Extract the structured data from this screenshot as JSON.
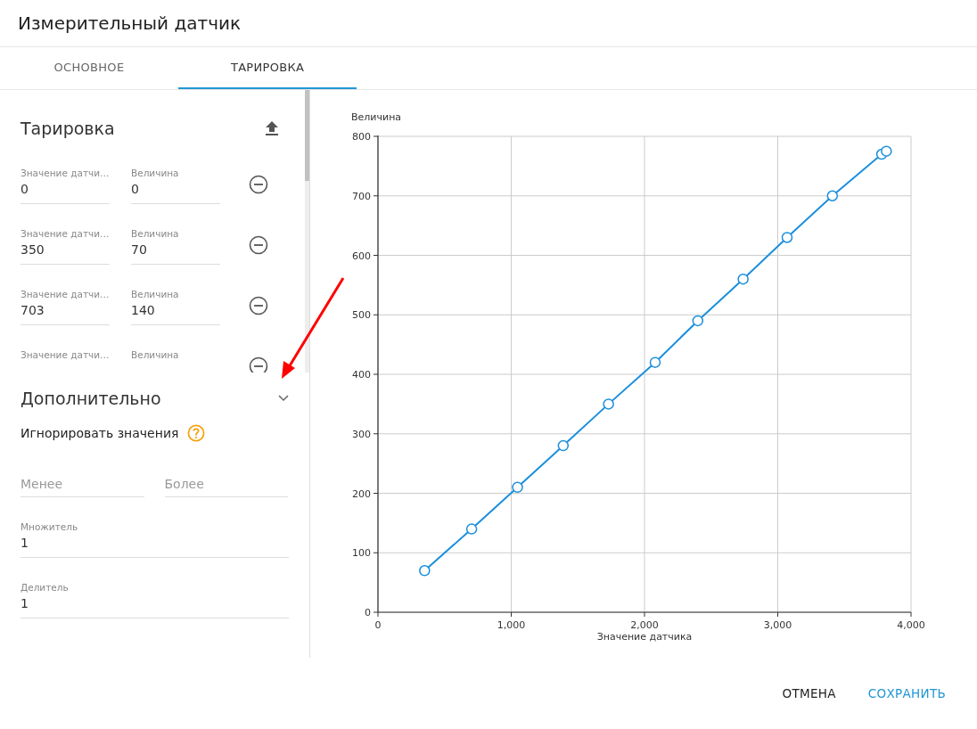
{
  "dialog": {
    "title": "Измерительный датчик"
  },
  "tabs": [
    {
      "label": "ОСНОВНОЕ",
      "selected": false
    },
    {
      "label": "ТАРИРОВКА",
      "selected": true
    }
  ],
  "calibration": {
    "title": "Тарировка",
    "rows": [
      {
        "sensor_label": "Значение датчи…",
        "sensor_value": "0",
        "quantity_label": "Величина",
        "quantity_value": "0"
      },
      {
        "sensor_label": "Значение датчи…",
        "sensor_value": "350",
        "quantity_label": "Величина",
        "quantity_value": "70"
      },
      {
        "sensor_label": "Значение датчи…",
        "sensor_value": "703",
        "quantity_label": "Величина",
        "quantity_value": "140"
      },
      {
        "sensor_label": "Значение датчи…",
        "quantity_label": "Величина"
      }
    ]
  },
  "additional": {
    "title": "Дополнительно",
    "ignore_label": "Игнорировать значения",
    "less": {
      "placeholder": "Менее"
    },
    "more": {
      "placeholder": "Более"
    },
    "multiplier": {
      "label": "Множитель",
      "value": "1"
    },
    "divider": {
      "label": "Делитель",
      "value": "1"
    }
  },
  "chart": {
    "chart_data": {
      "type": "line",
      "xlabel": "Значение датчика",
      "ylabel": "Величина",
      "xlim": [
        0,
        4000
      ],
      "ylim": [
        0,
        800
      ],
      "xticks": [
        0,
        {
          "value": 1000,
          "label": "1,000"
        },
        {
          "value": 2000,
          "label": "2,000"
        },
        {
          "value": 3000,
          "label": "3,000"
        },
        {
          "value": 4000,
          "label": "4,000"
        }
      ],
      "yticks": [
        0,
        100,
        200,
        300,
        400,
        500,
        600,
        700,
        800
      ],
      "x": [
        350,
        703,
        1047,
        1390,
        1730,
        2080,
        2400,
        2740,
        3070,
        3410,
        3780,
        3815
      ],
      "grid": true,
      "series": [
        {
          "color": "#1a8fdc",
          "marker": "circle",
          "values": [
            70,
            140,
            210,
            280,
            350,
            420,
            490,
            560,
            630,
            700,
            770,
            775
          ]
        }
      ]
    }
  },
  "buttons": [
    {
      "label": "ОТМЕНА",
      "kind": "secondary"
    },
    {
      "label": "СОХРАНИТЬ",
      "kind": "primary"
    }
  ]
}
